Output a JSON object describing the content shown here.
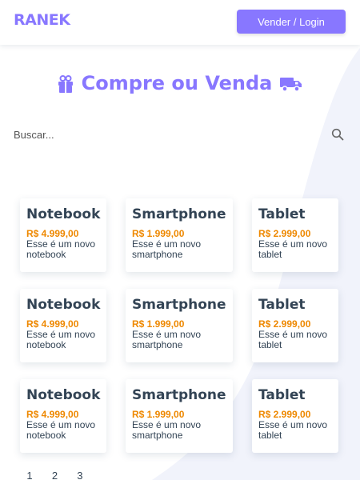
{
  "header": {
    "logo": "RANEK",
    "login_label": "Vender / Login"
  },
  "hero": {
    "title": "Compre ou Venda"
  },
  "search": {
    "placeholder": "Buscar..."
  },
  "products": [
    {
      "title": "Notebook",
      "price": "R$ 4.999,00",
      "description": "Esse é um novo notebook"
    },
    {
      "title": "Smartphone",
      "price": "R$ 1.999,00",
      "description": "Esse é um novo smartphone"
    },
    {
      "title": "Tablet",
      "price": "R$ 2.999,00",
      "description": "Esse é um novo tablet"
    },
    {
      "title": "Notebook",
      "price": "R$ 4.999,00",
      "description": "Esse é um novo notebook"
    },
    {
      "title": "Smartphone",
      "price": "R$ 1.999,00",
      "description": "Esse é um novo smartphone"
    },
    {
      "title": "Tablet",
      "price": "R$ 2.999,00",
      "description": "Esse é um novo tablet"
    },
    {
      "title": "Notebook",
      "price": "R$ 4.999,00",
      "description": "Esse é um novo notebook"
    },
    {
      "title": "Smartphone",
      "price": "R$ 1.999,00",
      "description": "Esse é um novo smartphone"
    },
    {
      "title": "Tablet",
      "price": "R$ 2.999,00",
      "description": "Esse é um novo tablet"
    }
  ],
  "pagination": {
    "pages": [
      "1",
      "2",
      "3"
    ]
  },
  "colors": {
    "brand": "#8877ff",
    "price": "#ee8800",
    "text": "#334455"
  },
  "icons": {
    "hero_left": "gift-icon",
    "hero_right": "truck-icon",
    "search": "search-icon"
  }
}
